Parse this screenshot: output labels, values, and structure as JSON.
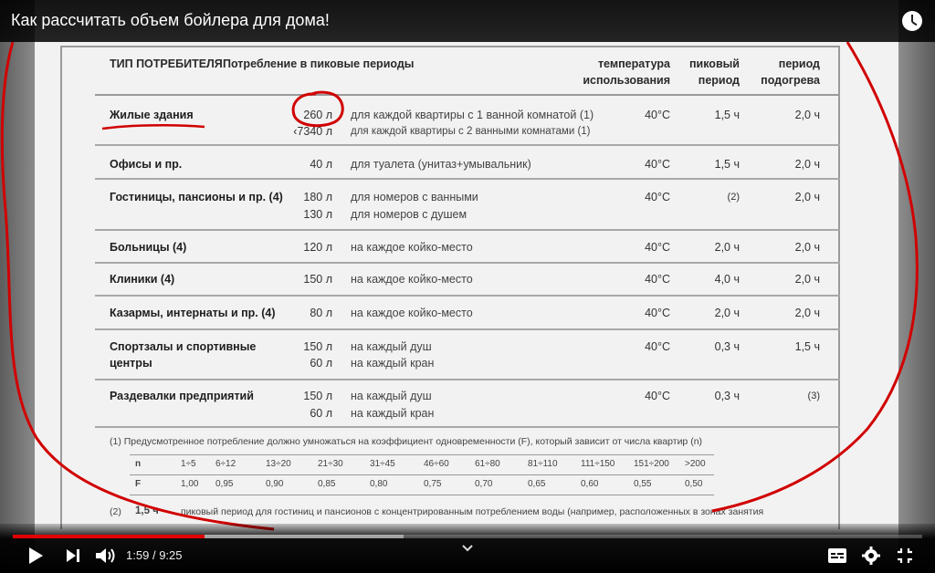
{
  "window": {
    "title": "Как рассчитать объем бойлера для дома!"
  },
  "player": {
    "current_time": "1:59",
    "separator": "/",
    "duration": "9:25",
    "progress_fraction": 0.2106,
    "buffered_fraction": 0.43
  },
  "table": {
    "headers": {
      "consumer": "ТИП ПОТРЕБИТЕЛЯ",
      "consumption": "Потребление в пиковые периоды",
      "temp_line1": "температура",
      "temp_line2": "использования",
      "peak_line1": "пиковый",
      "peak_line2": "период",
      "heat_line1": "период",
      "heat_line2": "подогрева"
    },
    "rows": [
      {
        "name": "Жилые здания",
        "amounts": [
          "260 л",
          "‹7340 л"
        ],
        "descs": [
          "для каждой квартиры с 1 ванной комнатой (1)",
          "для каждой квартиры с 2 ванными комнатами (1)"
        ],
        "temp": "40°C",
        "peak": "1,5 ч",
        "heat": "2,0 ч"
      },
      {
        "name": "Офисы и пр.",
        "amounts": [
          "40 л"
        ],
        "descs": [
          "для туалета (унитаз+умывальник)"
        ],
        "temp": "40°C",
        "peak": "1,5 ч",
        "heat": "2,0 ч"
      },
      {
        "name": "Гостиницы, пансионы и пр. (4)",
        "amounts": [
          "180 л",
          "130 л"
        ],
        "descs": [
          "для номеров с ванными",
          "для номеров с душем"
        ],
        "temp": "40°C",
        "peak": "(2)",
        "heat": "2,0 ч"
      },
      {
        "name": "Больницы (4)",
        "amounts": [
          "120 л"
        ],
        "descs": [
          "на каждое койко-место"
        ],
        "temp": "40°C",
        "peak": "2,0 ч",
        "heat": "2,0 ч"
      },
      {
        "name": "Клиники (4)",
        "amounts": [
          "150 л"
        ],
        "descs": [
          "на каждое койко-место"
        ],
        "temp": "40°C",
        "peak": "4,0 ч",
        "heat": "2,0 ч"
      },
      {
        "name": "Казармы, интернаты и пр. (4)",
        "amounts": [
          "80 л"
        ],
        "descs": [
          "на каждое койко-место"
        ],
        "temp": "40°C",
        "peak": "2,0 ч",
        "heat": "2,0 ч"
      },
      {
        "name_line1": "Спортзалы и спортивные",
        "name_line2": "центры",
        "amounts": [
          "150 л",
          "60 л"
        ],
        "descs": [
          "на каждый душ",
          "на каждый кран"
        ],
        "temp": "40°C",
        "peak": "0,3 ч",
        "heat": "1,5 ч"
      },
      {
        "name": "Раздевалки предприятий",
        "amounts": [
          "150 л",
          "60 л"
        ],
        "descs": [
          "на каждый душ",
          "на каждый кран"
        ],
        "temp": "40°C",
        "peak": "0,3 ч",
        "heat": "(3)"
      }
    ],
    "footnote1": "(1)   Предусмотренное потребление должно умножаться на коэффициент одновременности (F), который зависит от числа квартир (n)",
    "factor_n_label": "n",
    "factor_f_label": "F",
    "factor_n": [
      "1÷5",
      "6÷12",
      "13÷20",
      "21÷30",
      "31÷45",
      "46÷60",
      "61÷80",
      "81÷110",
      "111÷150",
      "151÷200",
      ">200"
    ],
    "factor_f": [
      "1,00",
      "0,95",
      "0,90",
      "0,85",
      "0,80",
      "0,75",
      "0,70",
      "0,65",
      "0,60",
      "0,55",
      "0,50"
    ],
    "footnote2_num": "(2)",
    "footnote2_val": "1,5 ч",
    "footnote2_text": "пиковый период для  гостиниц и пансионов с концентрированным потреблением воды (например, расположенных в зонах занятия"
  },
  "annotation_color": "#d10000",
  "accent_color": "#e00000"
}
